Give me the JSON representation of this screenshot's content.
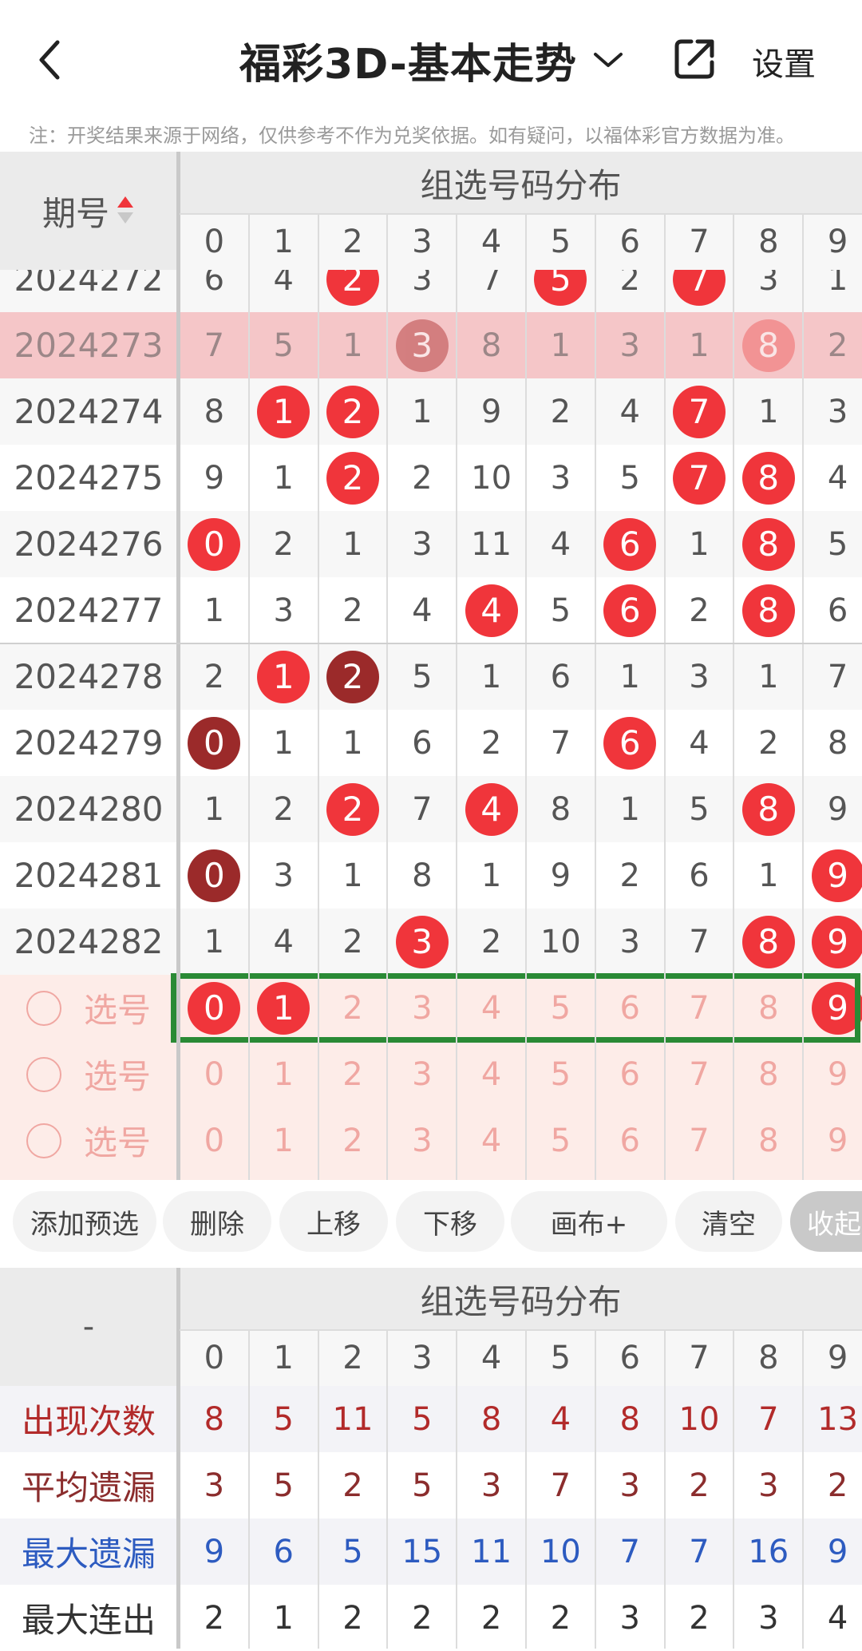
{
  "header": {
    "title": "福彩3D-基本走势",
    "settings_label": "设置",
    "note": "注：开奖结果来源于网络，仅供参考不作为兑奖依据。如有疑问，以福体彩官方数据为准。"
  },
  "table": {
    "period_header": "期号",
    "group_header": "组选号码分布",
    "digits": [
      "0",
      "1",
      "2",
      "3",
      "4",
      "5",
      "6",
      "7",
      "8",
      "9"
    ],
    "rows": [
      {
        "period": "2024272",
        "values": [
          "6",
          "4",
          "2",
          "3",
          "7",
          "5",
          "2",
          "7",
          "3",
          "1"
        ],
        "balls": [
          2,
          5,
          7
        ],
        "dark": []
      },
      {
        "period": "2024273",
        "values": [
          "7",
          "5",
          "1",
          "3",
          "8",
          "1",
          "3",
          "1",
          "8",
          "2"
        ],
        "balls": [
          3,
          8
        ],
        "dark": [],
        "highlight": true
      },
      {
        "period": "2024274",
        "values": [
          "8",
          "1",
          "2",
          "1",
          "9",
          "2",
          "4",
          "7",
          "1",
          "3"
        ],
        "balls": [
          1,
          2,
          7
        ],
        "dark": []
      },
      {
        "period": "2024275",
        "values": [
          "9",
          "1",
          "2",
          "2",
          "10",
          "3",
          "5",
          "7",
          "8",
          "4"
        ],
        "balls": [
          2,
          7,
          8
        ],
        "dark": []
      },
      {
        "period": "2024276",
        "values": [
          "0",
          "2",
          "1",
          "3",
          "11",
          "4",
          "6",
          "1",
          "8",
          "5"
        ],
        "balls": [
          0,
          6,
          8
        ],
        "dark": []
      },
      {
        "period": "2024277",
        "values": [
          "1",
          "3",
          "2",
          "4",
          "4",
          "5",
          "6",
          "2",
          "8",
          "6"
        ],
        "balls": [
          4,
          6,
          8
        ],
        "dark": []
      },
      {
        "period": "2024278",
        "values": [
          "2",
          "1",
          "2",
          "5",
          "1",
          "6",
          "1",
          "3",
          "1",
          "7"
        ],
        "balls": [
          1
        ],
        "dark": [
          2
        ]
      },
      {
        "period": "2024279",
        "values": [
          "0",
          "1",
          "1",
          "6",
          "2",
          "7",
          "6",
          "4",
          "2",
          "8"
        ],
        "balls": [
          6
        ],
        "dark": [
          0
        ]
      },
      {
        "period": "2024280",
        "values": [
          "1",
          "2",
          "2",
          "7",
          "4",
          "8",
          "1",
          "5",
          "8",
          "9"
        ],
        "balls": [
          2,
          4,
          8
        ],
        "dark": []
      },
      {
        "period": "2024281",
        "values": [
          "0",
          "3",
          "1",
          "8",
          "1",
          "9",
          "2",
          "6",
          "1",
          "9"
        ],
        "balls": [
          9
        ],
        "dark": [
          0
        ]
      },
      {
        "period": "2024282",
        "values": [
          "1",
          "4",
          "2",
          "3",
          "2",
          "10",
          "3",
          "7",
          "8",
          "9"
        ],
        "balls": [
          3,
          8,
          9
        ],
        "dark": []
      }
    ],
    "select_label": "选号",
    "select_rows": [
      {
        "selected": [
          0,
          1,
          9
        ]
      },
      {
        "selected": []
      },
      {
        "selected": []
      }
    ]
  },
  "buttons": [
    "添加预选",
    "删除",
    "上移",
    "下移",
    "画布+",
    "清空",
    "收起"
  ],
  "stats": {
    "corner": "-",
    "group_header": "组选号码分布",
    "rows": [
      {
        "label": "出现次数",
        "values": [
          "8",
          "5",
          "11",
          "5",
          "8",
          "4",
          "8",
          "10",
          "7",
          "13"
        ],
        "color": "#b22a2a"
      },
      {
        "label": "平均遗漏",
        "values": [
          "3",
          "5",
          "2",
          "5",
          "3",
          "7",
          "3",
          "2",
          "3",
          "2"
        ],
        "color": "#8b2d2d"
      },
      {
        "label": "最大遗漏",
        "values": [
          "9",
          "6",
          "5",
          "15",
          "11",
          "10",
          "7",
          "7",
          "16",
          "9"
        ],
        "color": "#2d5bc0"
      },
      {
        "label": "最大连出",
        "values": [
          "2",
          "1",
          "2",
          "2",
          "2",
          "2",
          "3",
          "2",
          "3",
          "4"
        ],
        "color": "#333333"
      }
    ]
  },
  "colors": {
    "ball": "#f0353b",
    "ball_dark": "#9b2a2a",
    "highlight_row": "#f5c6c8",
    "select_bg": "#fdece8",
    "select_frame": "#2a8a35",
    "muted_digit": "#f0a7a2"
  }
}
